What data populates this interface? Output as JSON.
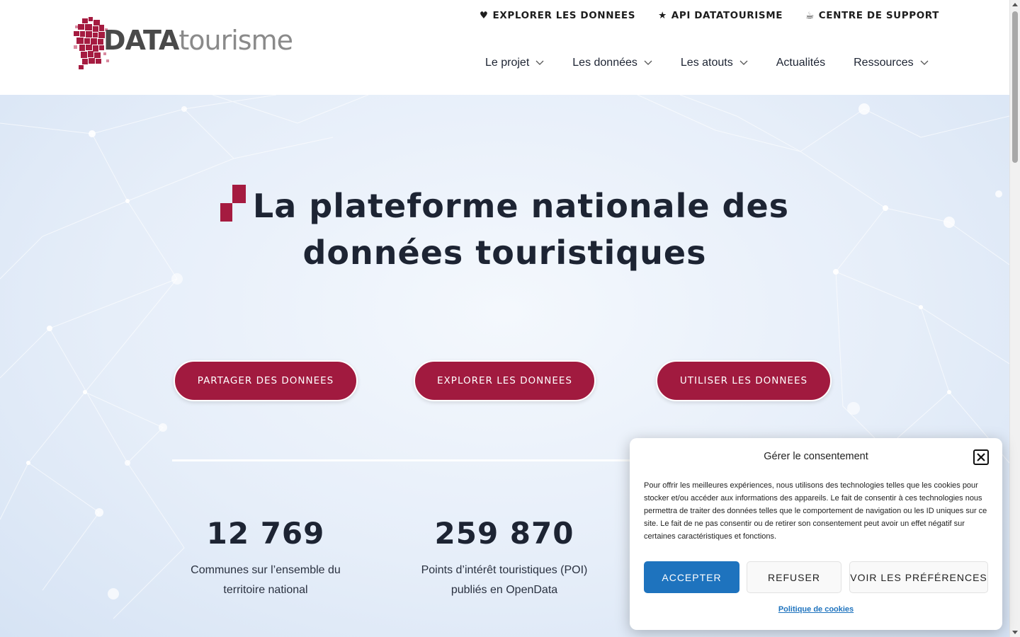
{
  "header": {
    "logo": {
      "part1": "DATA",
      "part2": "tourisme"
    },
    "topnav": [
      {
        "icon": "heart-icon",
        "glyph": "♥",
        "label": "EXPLORER LES DONNEES"
      },
      {
        "icon": "star-icon",
        "glyph": "★",
        "label": "API DATATOURISME"
      },
      {
        "icon": "coffee-icon",
        "glyph": "☕",
        "label": "CENTRE DE SUPPORT"
      }
    ],
    "mainnav": [
      {
        "label": "Le projet",
        "dropdown": true
      },
      {
        "label": "Les données",
        "dropdown": true
      },
      {
        "label": "Les atouts",
        "dropdown": true
      },
      {
        "label": "Actualités",
        "dropdown": false
      },
      {
        "label": "Ressources",
        "dropdown": true
      }
    ]
  },
  "hero": {
    "title_line1": "La plateforme nationale des",
    "title_line2": "données touristiques",
    "buttons": [
      {
        "label": "PARTAGER DES DONNEES"
      },
      {
        "label": "EXPLORER LES DONNEES"
      },
      {
        "label": "UTILISER LES DONNEES"
      }
    ],
    "stats": [
      {
        "number": "12 769",
        "label_line1": "Communes sur l’ensemble du",
        "label_line2": "territoire national"
      },
      {
        "number": "259 870",
        "label_line1": "Points d’intérêt touristiques (POI)",
        "label_line2": "publiés en OpenData"
      }
    ]
  },
  "consent": {
    "title": "Gérer le consentement",
    "body": "Pour offrir les meilleures expériences, nous utilisons des technologies telles que les cookies pour stocker et/ou accéder aux informations des appareils. Le fait de consentir à ces technologies nous permettra de traiter des données telles que le comportement de navigation ou les ID uniques sur ce site. Le fait de ne pas consentir ou de retirer son consentement peut avoir un effet négatif sur certaines caractéristiques et fonctions.",
    "accept": "ACCEPTER",
    "refuse": "REFUSER",
    "preferences": "VOIR LES PRÉFÉRENCES",
    "policy": "Politique de cookies"
  },
  "colors": {
    "brand": "#a11a3f",
    "accept": "#1e73be",
    "text": "#1d2433"
  }
}
